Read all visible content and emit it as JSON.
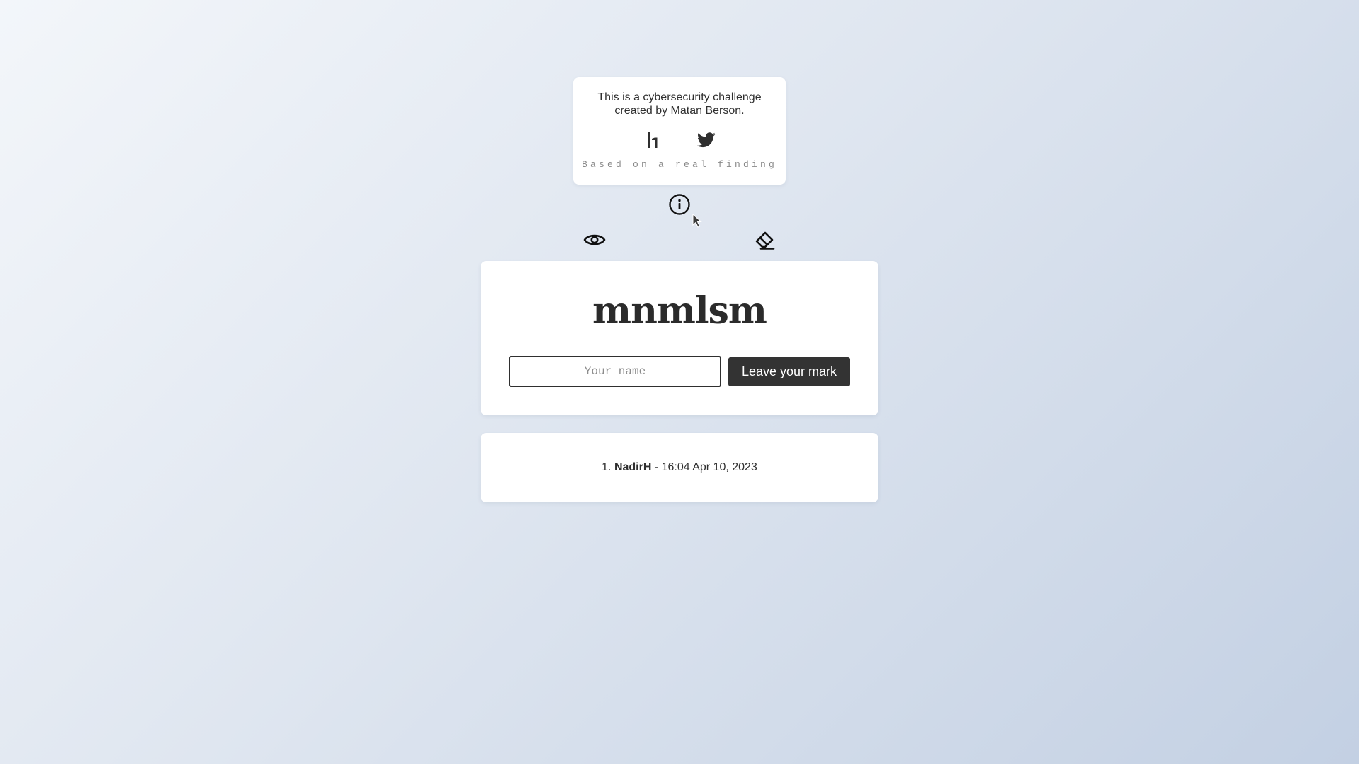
{
  "info_card": {
    "text": "This is a cybersecurity challenge created by Matan Berson.",
    "links": [
      {
        "icon": "hackerone-icon"
      },
      {
        "icon": "twitter-icon"
      }
    ],
    "footnote": "Based on a real finding"
  },
  "toolbar": {
    "info_icon": "info-circle-icon",
    "view_icon": "eye-icon",
    "clear_icon": "eraser-icon"
  },
  "main": {
    "title": "mnmlsm",
    "name_input": {
      "value": "",
      "placeholder": "Your name"
    },
    "submit_label": "Leave your mark"
  },
  "leaderboard": {
    "entries": [
      {
        "rank": "1.",
        "name": "NadirH",
        "separator": " - ",
        "timestamp": "16:04 Apr 10, 2023"
      }
    ]
  },
  "colors": {
    "card_bg": "#ffffff",
    "button_bg": "#333333",
    "text": "#2f2f2f",
    "muted": "#8a8a8a"
  }
}
